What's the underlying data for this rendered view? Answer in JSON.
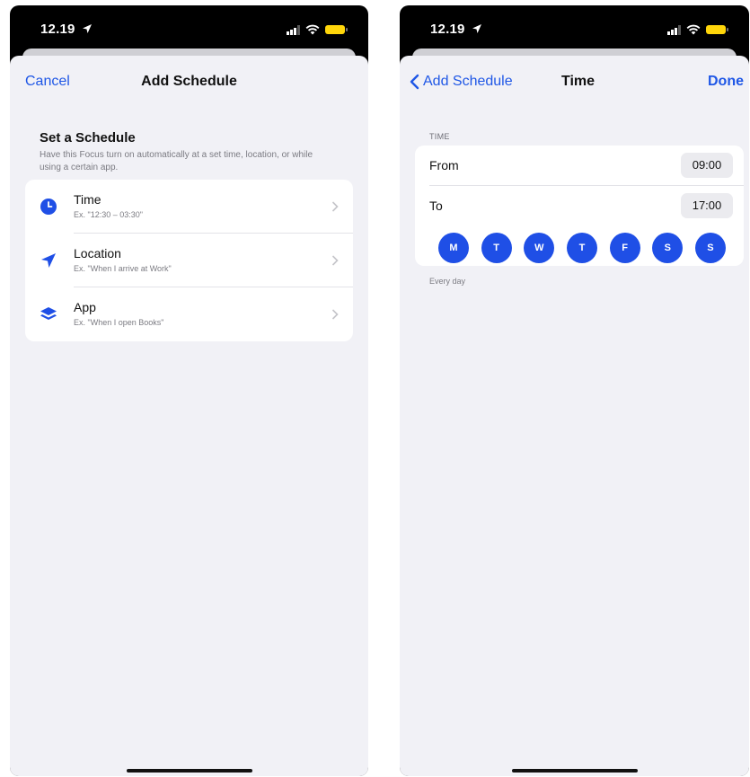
{
  "status_bar": {
    "time": "12.19"
  },
  "left_screen": {
    "nav": {
      "cancel_label": "Cancel",
      "title": "Add Schedule"
    },
    "section": {
      "title": "Set a Schedule",
      "description": "Have this Focus turn on automatically at a set time, location, or while using a certain app."
    },
    "options": [
      {
        "title": "Time",
        "subtitle": "Ex. \"12:30 – 03:30\"",
        "icon": "clock-icon"
      },
      {
        "title": "Location",
        "subtitle": "Ex. \"When I arrive at Work\"",
        "icon": "location-arrow-icon"
      },
      {
        "title": "App",
        "subtitle": "Ex. \"When I open Books\"",
        "icon": "app-stack-icon"
      }
    ]
  },
  "right_screen": {
    "nav": {
      "back_label": "Add Schedule",
      "title": "Time",
      "done_label": "Done"
    },
    "group_header": "TIME",
    "from": {
      "label": "From",
      "value": "09:00"
    },
    "to": {
      "label": "To",
      "value": "17:00"
    },
    "days": [
      "M",
      "T",
      "W",
      "T",
      "F",
      "S",
      "S"
    ],
    "footer": "Every day"
  },
  "colors": {
    "accent": "#1f57e6",
    "day_fill": "#1f4fe6",
    "battery": "#ffd60a",
    "background": "#f1f1f6"
  }
}
